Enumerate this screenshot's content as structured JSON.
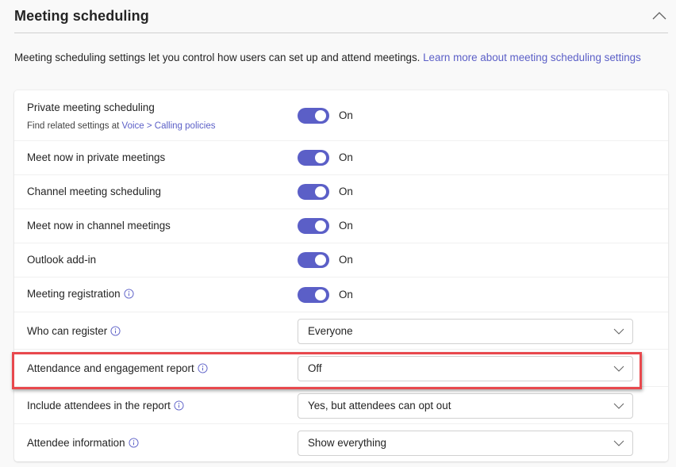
{
  "section": {
    "title": "Meeting scheduling",
    "collapse_icon": "chevron-up-icon"
  },
  "description": {
    "text": "Meeting scheduling settings let you control how users can set up and attend meetings. ",
    "link": "Learn more about meeting scheduling settings"
  },
  "colors": {
    "accent": "#5b5fc7",
    "highlight": "#e8484d",
    "text": "#242424"
  },
  "settings": [
    {
      "label": "Private meeting scheduling",
      "sub_prefix": "Find related settings at ",
      "sub_link_1": "Voice",
      "sub_sep": " > ",
      "sub_link_2": "Calling policies",
      "type": "toggle",
      "value": "On",
      "enabled": true
    },
    {
      "label": "Meet now in private meetings",
      "type": "toggle",
      "value": "On",
      "enabled": true
    },
    {
      "label": "Channel meeting scheduling",
      "type": "toggle",
      "value": "On",
      "enabled": true
    },
    {
      "label": "Meet now in channel meetings",
      "type": "toggle",
      "value": "On",
      "enabled": true
    },
    {
      "label": "Outlook add-in",
      "type": "toggle",
      "value": "On",
      "enabled": true
    },
    {
      "label": "Meeting registration",
      "type": "toggle",
      "value": "On",
      "enabled": true,
      "info": true
    },
    {
      "label": "Who can register",
      "type": "dropdown",
      "value": "Everyone",
      "info": true
    },
    {
      "label": "Attendance and engagement report",
      "type": "dropdown",
      "value": "Off",
      "info": true,
      "highlighted": true
    },
    {
      "label": "Include attendees in the report",
      "type": "dropdown",
      "value": "Yes, but attendees can opt out",
      "info": true
    },
    {
      "label": "Attendee information",
      "type": "dropdown",
      "value": "Show everything",
      "info": true
    }
  ]
}
